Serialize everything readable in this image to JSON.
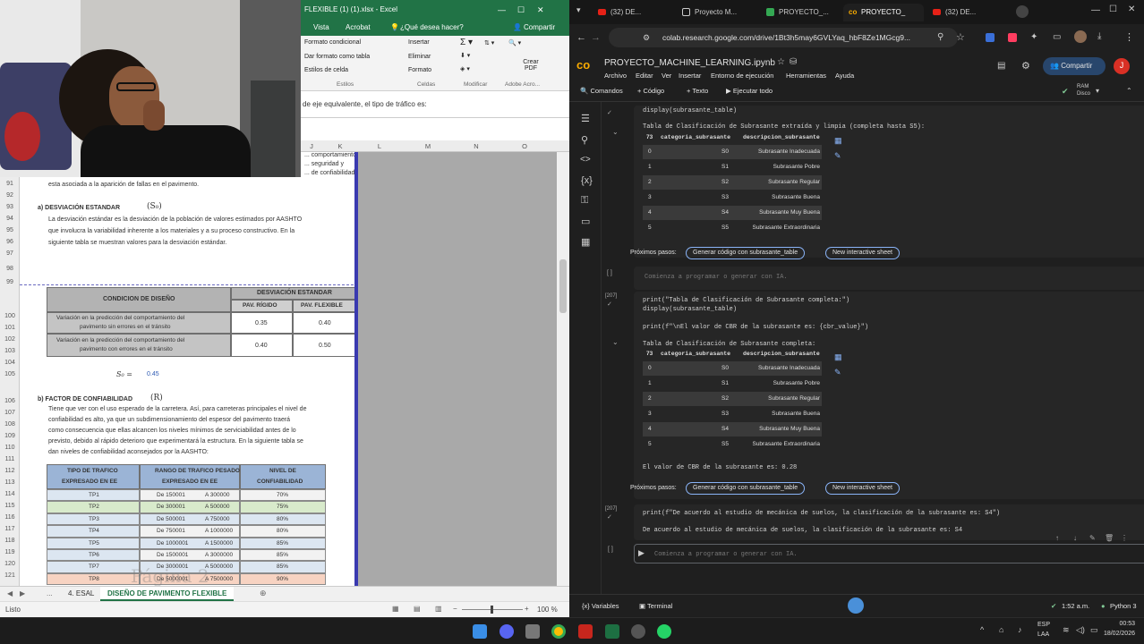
{
  "excel": {
    "title": "FLEXIBLE (1) (1).xlsx - Excel",
    "search": "¿Qué desea hacer?",
    "share": "Compartir",
    "tabs": [
      "Vista",
      "Acrobat"
    ],
    "ribbon": {
      "items": [
        "Formato condicional",
        "Dar formato como tabla",
        "Estilos de celda",
        "Insertar",
        "Eliminar",
        "Formato",
        "Crear PDF"
      ],
      "groups": [
        "Estilos",
        "Celdas",
        "Modificar",
        "Adobe Acro..."
      ]
    },
    "formula": "de eje equivalente, el tipo de tráfico es:",
    "columns": [
      "J",
      "K",
      "L",
      "M",
      "N",
      "O"
    ],
    "rows": [
      "91",
      "92",
      "93",
      "94",
      "95",
      "96",
      "97",
      "98",
      "99",
      "100",
      "101",
      "102",
      "103",
      "104",
      "105",
      "106",
      "107",
      "108",
      "109",
      "110",
      "111",
      "112",
      "113",
      "114",
      "115",
      "116",
      "117",
      "118",
      "119",
      "120",
      "121"
    ],
    "doc": {
      "top_frag": [
        "... comportamiento",
        "... seguridad y",
        "... de confiabilidad"
      ],
      "line0": "esta asociada a la aparición de fallas en el pavimento.",
      "sec_a": "a)  DESVIACIÓN ESTANDAR",
      "sym_a": "(S₀)",
      "para_a": [
        "La desviación estándar es la desviación de la población de valores estimados por AASHTO",
        "que involucra la variabilidad inherente a los materiales y a su proceso constructivo. En la",
        "siguiente tabla se muestran valores para la desviación estándar."
      ],
      "t1_h1": "CONDICION DE DISEÑO",
      "t1_h2": "DESVIACIÓN ESTANDAR",
      "t1_h3": "PAV. RÍGIDO",
      "t1_h4": "PAV. FLEXIBLE",
      "t1_r1": [
        "Variación en la predicción del comportamiento del",
        "pavimento sin errores en el tránsito"
      ],
      "t1_r1v": [
        "0.35",
        "0.40"
      ],
      "t1_r2": [
        "Variación en la predicción del comportamiento del",
        "pavimento con errores en el tránsito"
      ],
      "t1_r2v": [
        "0.40",
        "0.50"
      ],
      "s0_label": "S₀ =",
      "s0_value": "0.45",
      "sec_b": "b)  FACTOR DE CONFIABILIDAD",
      "sym_b": "(R)",
      "para_b": [
        "Tiene que ver con el uso esperado de la carretera. Así, para carreteras principales el nivel de",
        "confiabilidad es alto, ya que un subdimensionamiento del espesor del pavimento traerá",
        "como consecuencia que ellas alcancen los niveles mínimos de serviciabilidad antes de lo",
        "previsto, debido al rápido deterioro que experimentará la estructura. En la siguiente tabla se",
        "dan niveles de confiabilidad aconsejados por la AASHTO:"
      ],
      "t2_h": [
        "TIPO DE TRAFICO",
        "EXPRESADO EN EE",
        "RANGO DE TRAFICO PESADO",
        "EXPRESADO EN EE",
        "NIVEL DE",
        "CONFIABILIDAD"
      ],
      "t2_rows": [
        [
          "TP1",
          "De 150001",
          "A 300000",
          "70%"
        ],
        [
          "TP2",
          "De 300001",
          "A 500000",
          "75%"
        ],
        [
          "TP3",
          "De 500001",
          "A 750000",
          "80%"
        ],
        [
          "TP4",
          "De 750001",
          "A 1000000",
          "80%"
        ],
        [
          "TP5",
          "De 1000001",
          "A 1500000",
          "85%"
        ],
        [
          "TP6",
          "De 1500001",
          "A 3000000",
          "85%"
        ],
        [
          "TP7",
          "De 3000001",
          "A 5000000",
          "85%"
        ],
        [
          "TP8",
          "De 5000001",
          "A 7500000",
          "90%"
        ]
      ]
    },
    "sheet_nav": "...",
    "sheets": [
      "4. ESAL",
      "DISEÑO DE PAVIMENTO FLEXIBLE"
    ],
    "status_left": "Listo",
    "zoom": "100 %"
  },
  "chrome": {
    "tabs": [
      "(32) DE...",
      "Proyecto M...",
      "PROYECTO_...",
      "PROYECTO_",
      "(32) DE..."
    ],
    "url": "colab.research.google.com/drive/1Bt3h5may6GVLYaq_hbF8Ze1MGcg9...",
    "notebook_title": "PROYECTO_MACHINE_LEARNING.ipynb",
    "menu": [
      "Archivo",
      "Editar",
      "Ver",
      "Insertar",
      "Entorno de ejecución",
      "Herramientas",
      "Ayuda"
    ],
    "share": "Compartir",
    "avatar": "J",
    "toolbar": [
      "Comandos",
      "+ Código",
      "+ Texto",
      "Ejecutar todo"
    ],
    "ram": [
      "RAM",
      "Disco"
    ],
    "cell1_code": "display(subrasante_table)",
    "out1_title": "Tabla de Clasificación de Subrasante extraída y limpia (completa hasta S5):",
    "table_header": [
      "categoria_subrasante",
      "descripcion_subrasante"
    ],
    "table_rows": [
      [
        "0",
        "S0",
        "Subrasante Inadecuada"
      ],
      [
        "1",
        "S1",
        "Subrasante Pobre"
      ],
      [
        "2",
        "S2",
        "Subrasante Regular"
      ],
      [
        "3",
        "S3",
        "Subrasante Buena"
      ],
      [
        "4",
        "S4",
        "Subrasante Muy Buena"
      ],
      [
        "5",
        "S5",
        "Subrasante Extraordinaria"
      ]
    ],
    "next_steps": "Próximos pasos:",
    "chip1": "Generar código con subrasante_table",
    "chip2": "New interactive sheet",
    "empty_prompt": "Comienza a programar o generar con IA.",
    "cell2_count": "[207]",
    "cell2_line1": "print(\"Tabla de Clasificación de Subrasante completa:\")",
    "cell2_line2": "display(subrasante_table)",
    "cell2_line3": "print(f\"\\nEl valor de CBR de la subrasante es: {cbr_value}\")",
    "out2_title": "Tabla de Clasificación de Subrasante completa:",
    "cbr_text": "El valor de CBR de la subrasante es: 0.28",
    "cell3_count": "[207]",
    "cell3_code": "print(f\"De acuerdo al estudio de mecánica de suelos, la clasificación de la subrasante es: S4\")",
    "out3": "De acuerdo al estudio de mecánica de suelos, la clasificación de la subrasante es: S4",
    "status": [
      "Variables",
      "Terminal"
    ],
    "status_right": [
      "1:52 a.m.",
      "Python 3"
    ]
  },
  "taskbar": {
    "lang": [
      "ESP",
      "LAA"
    ],
    "time": "00:53",
    "date": "18/02/2026"
  },
  "colors": {
    "excel_green": "#217346",
    "colab_bg": "#1f1f1f",
    "chip_border": "#8ab4f8",
    "accent": "#1a73e8"
  }
}
